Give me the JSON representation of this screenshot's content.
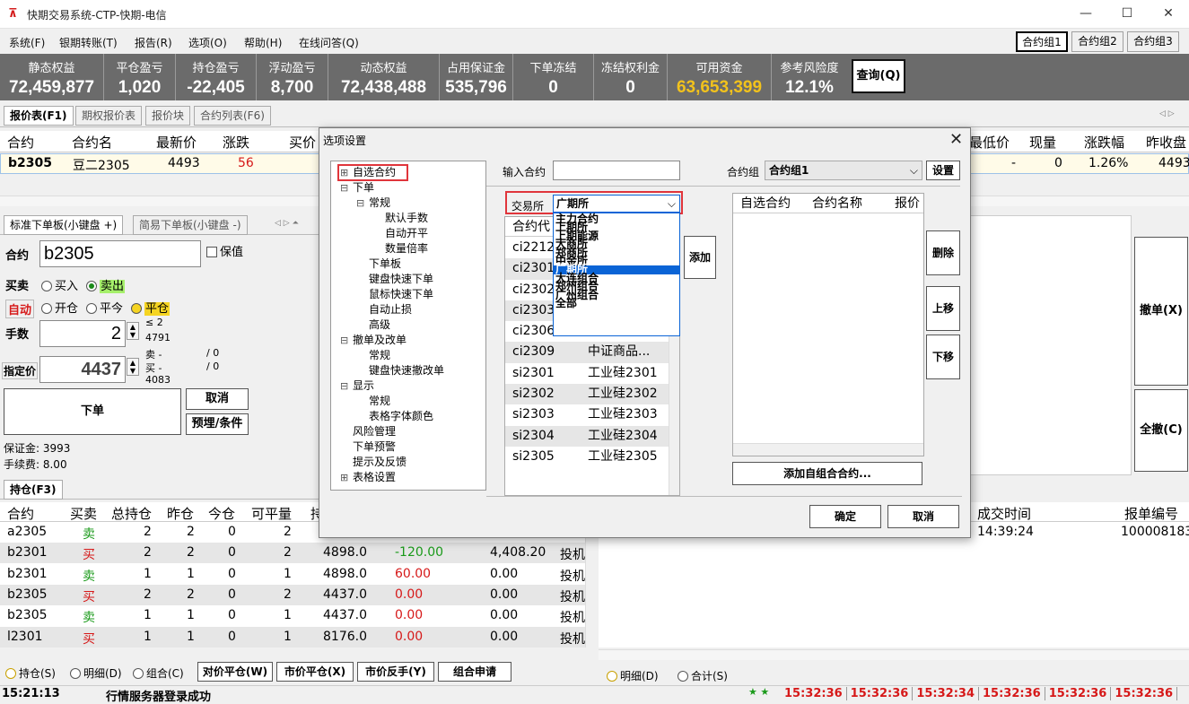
{
  "window": {
    "title": "快期交易系统-CTP-快期-电信",
    "min": "—",
    "max": "☐",
    "close": "✕"
  },
  "menu": [
    "系统(F)",
    "银期转账(T)",
    "报告(R)",
    "选项(O)",
    "帮助(H)",
    "在线问答(Q)"
  ],
  "groups": [
    "合约组1",
    "合约组2",
    "合约组3"
  ],
  "account": [
    {
      "label": "静态权益",
      "value": "72,459,877"
    },
    {
      "label": "平仓盈亏",
      "value": "1,020"
    },
    {
      "label": "持仓盈亏",
      "value": "-22,405"
    },
    {
      "label": "浮动盈亏",
      "value": "8,700"
    },
    {
      "label": "动态权益",
      "value": "72,438,488"
    },
    {
      "label": "占用保证金",
      "value": "535,796"
    },
    {
      "label": "下单冻结",
      "value": "0"
    },
    {
      "label": "冻结权利金",
      "value": "0"
    },
    {
      "label": "可用资金",
      "value": "63,653,399"
    },
    {
      "label": "参考风险度",
      "value": "12.1%"
    }
  ],
  "query_btn": "查询(Q)",
  "quote_tabs": [
    "报价表(F1)",
    "期权报价表",
    "报价块",
    "合约列表(F6)"
  ],
  "quote_headers_left": [
    "合约",
    "合约名",
    "最新价",
    "涨跌",
    "买价"
  ],
  "quote_headers_right": [
    "最低价",
    "现量",
    "涨跌幅",
    "昨收盘"
  ],
  "quote_row": {
    "code": "b2305",
    "name": "豆二2305",
    "last": "4493",
    "chg": "56",
    "low": "-",
    "vol": "0",
    "pct": "1.26%",
    "prev": "4493"
  },
  "order_tabs": [
    "标准下单板(小键盘 +)",
    "简易下单板(小键盘 -)"
  ],
  "order": {
    "contract_label": "合约",
    "contract": "b2305",
    "keep_label": "保值",
    "side_label": "买卖",
    "buy": "买入",
    "sell": "卖出",
    "auto": "自动",
    "open": "开仓",
    "close_today": "平今",
    "close": "平仓",
    "qty_label": "手数",
    "qty": "2",
    "qty_le": "≤ 2",
    "qty_max": "4791",
    "price_label": "指定价",
    "price": "4437",
    "sell_row": "卖 -",
    "sell_sl": "/ 0",
    "buy_row": "买 -",
    "buy_sl": "/ 0",
    "up_val": "4083",
    "submit": "下单",
    "cancel": "取消",
    "cond": "预埋/条件",
    "margin": "保证金:  3993",
    "fee": "手续费:  8.00"
  },
  "right_buttons": [
    "撤单(X)",
    "全撤(C)"
  ],
  "pos_tab": "持仓(F3)",
  "pos_headers": [
    "合约",
    "买卖",
    "总持仓",
    "昨仓",
    "今仓",
    "可平量",
    "持"
  ],
  "positions": [
    {
      "code": "a2305",
      "side": "卖",
      "total": "2",
      "yd": "2",
      "td": "0",
      "avail": "2",
      "price": "",
      "pnl": "",
      "margin": "",
      "type": ""
    },
    {
      "code": "b2301",
      "side": "买",
      "total": "2",
      "yd": "2",
      "td": "0",
      "avail": "2",
      "price": "4898.0",
      "pnl": "-120.00",
      "margin": "4,408.20",
      "type": "投机"
    },
    {
      "code": "b2301",
      "side": "卖",
      "total": "1",
      "yd": "1",
      "td": "0",
      "avail": "1",
      "price": "4898.0",
      "pnl": "60.00",
      "margin": "0.00",
      "type": "投机"
    },
    {
      "code": "b2305",
      "side": "买",
      "total": "2",
      "yd": "2",
      "td": "0",
      "avail": "2",
      "price": "4437.0",
      "pnl": "0.00",
      "margin": "0.00",
      "type": "投机"
    },
    {
      "code": "b2305",
      "side": "卖",
      "total": "1",
      "yd": "1",
      "td": "0",
      "avail": "1",
      "price": "4437.0",
      "pnl": "0.00",
      "margin": "0.00",
      "type": "投机"
    },
    {
      "code": "l2301",
      "side": "买",
      "total": "1",
      "yd": "1",
      "td": "0",
      "avail": "1",
      "price": "8176.0",
      "pnl": "0.00",
      "margin": "0.00",
      "type": "投机"
    }
  ],
  "pos_footer": {
    "r1": "持仓(S)",
    "r2": "明细(D)",
    "r3": "组合(C)",
    "b1": "对价平仓(W)",
    "b2": "市价平仓(X)",
    "b3": "市价反手(Y)",
    "b4": "组合申请"
  },
  "trade_headers": [
    "成交时间",
    "报单编号"
  ],
  "trade_row": {
    "time": "14:39:24",
    "id": "100008183"
  },
  "trade_footer": {
    "r1": "明细(D)",
    "r2": "合计(S)"
  },
  "status": {
    "time": "15:21:13",
    "msg": "行情服务器登录成功",
    "times": [
      "15:32:36",
      "15:32:36",
      "15:32:34",
      "15:32:36",
      "15:32:36",
      "15:32:36"
    ]
  },
  "dialog": {
    "title": "选项设置",
    "tree": [
      {
        "t": "自选合约",
        "lvl": 0,
        "exp": "⊞"
      },
      {
        "t": "下单",
        "lvl": 0,
        "exp": "⊟"
      },
      {
        "t": "常规",
        "lvl": 1,
        "exp": "⊟"
      },
      {
        "t": "默认手数",
        "lvl": 2
      },
      {
        "t": "自动开平",
        "lvl": 2
      },
      {
        "t": "数量倍率",
        "lvl": 2
      },
      {
        "t": "下单板",
        "lvl": 1
      },
      {
        "t": "键盘快速下单",
        "lvl": 1
      },
      {
        "t": "鼠标快速下单",
        "lvl": 1
      },
      {
        "t": "自动止损",
        "lvl": 1
      },
      {
        "t": "高级",
        "lvl": 1
      },
      {
        "t": "撤单及改单",
        "lvl": 0,
        "exp": "⊟"
      },
      {
        "t": "常规",
        "lvl": 1
      },
      {
        "t": "键盘快速撤改单",
        "lvl": 1
      },
      {
        "t": "显示",
        "lvl": 0,
        "exp": "⊟"
      },
      {
        "t": "常规",
        "lvl": 1
      },
      {
        "t": "表格字体颜色",
        "lvl": 1
      },
      {
        "t": "风险管理",
        "lvl": 0
      },
      {
        "t": "下单预警",
        "lvl": 0
      },
      {
        "t": "提示及反馈",
        "lvl": 0
      },
      {
        "t": "表格设置",
        "lvl": 0,
        "exp": "⊞"
      }
    ],
    "input_label": "输入合约",
    "group_label": "合约组",
    "group_value": "合约组1",
    "settings_btn": "设置",
    "exchange_label": "交易所",
    "exchange_value": "广期所",
    "exchange_options": [
      "主力合约",
      "上期所",
      "上期能源",
      "大商所",
      "郑商所",
      "中金所",
      "广期所",
      "大连组合",
      "郑州组合",
      "广州组合",
      "全部"
    ],
    "list_header": "合约代",
    "list": [
      {
        "code": "ci2212",
        "name": ""
      },
      {
        "code": "ci2301",
        "name": ""
      },
      {
        "code": "ci2302",
        "name": ""
      },
      {
        "code": "ci2303",
        "name": ""
      },
      {
        "code": "ci2306",
        "name": ""
      },
      {
        "code": "ci2309",
        "name": "中证商品..."
      },
      {
        "code": "si2301",
        "name": "工业硅2301"
      },
      {
        "code": "si2302",
        "name": "工业硅2302"
      },
      {
        "code": "si2303",
        "name": "工业硅2303"
      },
      {
        "code": "si2304",
        "name": "工业硅2304"
      },
      {
        "code": "si2305",
        "name": "工业硅2305"
      }
    ],
    "add_btn": "添加",
    "fav_headers": [
      "自选合约",
      "合约名称",
      "报价"
    ],
    "del_btn": "删除",
    "up_btn": "上移",
    "down_btn": "下移",
    "add_combo_btn": "添加自组合合约...",
    "ok_btn": "确定",
    "cancel_btn": "取消"
  }
}
